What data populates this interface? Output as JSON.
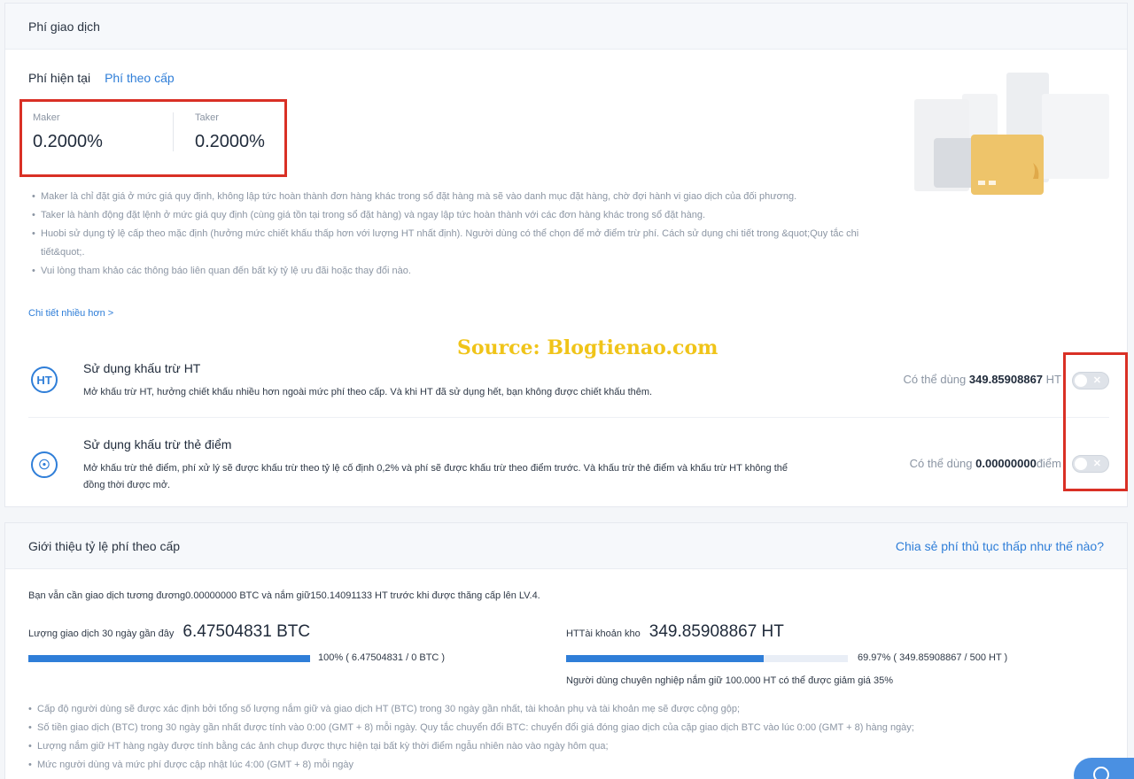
{
  "fee_panel": {
    "title": "Phí giao dịch",
    "tabs": {
      "current": "Phí hiện tại",
      "by_level": "Phí theo cấp"
    },
    "maker": {
      "label": "Maker",
      "value": "0.2000%"
    },
    "taker": {
      "label": "Taker",
      "value": "0.2000%"
    },
    "notes": [
      "Maker là chỉ đặt giá ở mức giá quy định, không lập tức hoàn thành đơn hàng khác trong sổ đặt hàng mà sẽ vào danh mục đặt hàng, chờ đợi hành vi giao dịch của đối phương.",
      "Taker là hành động đặt lệnh ở mức giá quy định (cùng giá tồn tại trong sổ đặt hàng) và ngay lập tức hoàn thành với các đơn hàng khác trong sổ đặt hàng.",
      "Huobi sử dụng tỷ lệ cấp theo mặc định (hưởng mức chiết khấu thấp hơn với lượng HT nhất định). Người dùng có thể chọn để mở điểm trừ phí. Cách sử dụng chi tiết trong &quot;Quy tắc chi tiết&quot;.",
      "Vui lòng tham khảo các thông báo liên quan đến bất kỳ tỷ lệ ưu đãi hoặc thay đổi nào."
    ],
    "more_link": "Chi tiết nhiều hơn >",
    "watermark": "Source: Blogtienao.com",
    "ht_option": {
      "icon_text": "HT",
      "title": "Sử dụng khấu trừ HT",
      "desc": "Mở khấu trừ HT, hưởng chiết khấu nhiều hơn ngoài mức phí theo cấp. Và khi HT đã sử dụng hết, bạn không được chiết khấu thêm.",
      "avail_prefix": "Có thể dùng ",
      "avail_value": "349.85908867",
      "avail_unit": " HT"
    },
    "point_option": {
      "icon_text": "☉",
      "title": "Sử dụng khấu trừ thẻ điểm",
      "desc": "Mở khấu trừ thẻ điểm, phí xử lý sẽ được khấu trừ theo tỷ lệ cố định 0,2% và phí sẽ được khấu trừ theo điểm trước. Và khấu trừ thẻ điểm và khấu trừ HT không thể đồng thời được mở.",
      "avail_prefix": "Có thể dùng ",
      "avail_value": "0.00000000",
      "avail_unit": "điểm"
    },
    "toggle_off_glyph": "✕"
  },
  "tier_panel": {
    "title": "Giới thiệu tỷ lệ phí theo cấp",
    "share_link": "Chia sẻ phí thủ tục thấp như thế nào?",
    "upgrade_text": "Bạn vẫn cần giao dịch tương đương0.00000000 BTC và nắm giữ150.14091133 HT trước khi được thăng cấp lên LV.4.",
    "volume": {
      "label": "Lượng giao dịch 30 ngày gần đây",
      "value": "6.47504831 BTC",
      "progress": 1.0,
      "progress_text": "100%   ( 6.47504831 / 0 BTC )"
    },
    "ht_holding": {
      "label": "HTTài khoản kho",
      "value": "349.85908867 HT",
      "progress": 0.6997,
      "progress_text": "69.97%   ( 349.85908867 / 500 HT )"
    },
    "pro_note": "Người dùng chuyên nghiệp nắm giữ 100.000 HT có thể được giảm giá 35%",
    "notes": [
      "Cấp độ người dùng sẽ được xác định bởi tổng số lượng nắm giữ và giao dịch HT (BTC) trong 30 ngày gần nhất, tài khoản phụ và tài khoản mẹ sẽ được cộng gộp;",
      "Số tiền giao dịch (BTC) trong 30 ngày gần nhất được tính vào 0:00 (GMT + 8) mỗi ngày. Quy tắc chuyển đổi BTC: chuyển đổi giá đóng giao dịch của cặp giao dịch BTC vào lúc 0:00 (GMT + 8) hàng ngày;",
      "Lượng nắm giữ HT hàng ngày được tính bằng các ảnh chụp được thực hiện tại bất kỳ thời điểm ngẫu nhiên nào vào ngày hôm qua;",
      "Mức người dùng và mức phí được cập nhật lúc 4:00 (GMT + 8) mỗi ngày"
    ]
  },
  "colors": {
    "accent": "#2f7ed8",
    "highlight_box": "#d93025",
    "watermark": "#f0c419"
  }
}
